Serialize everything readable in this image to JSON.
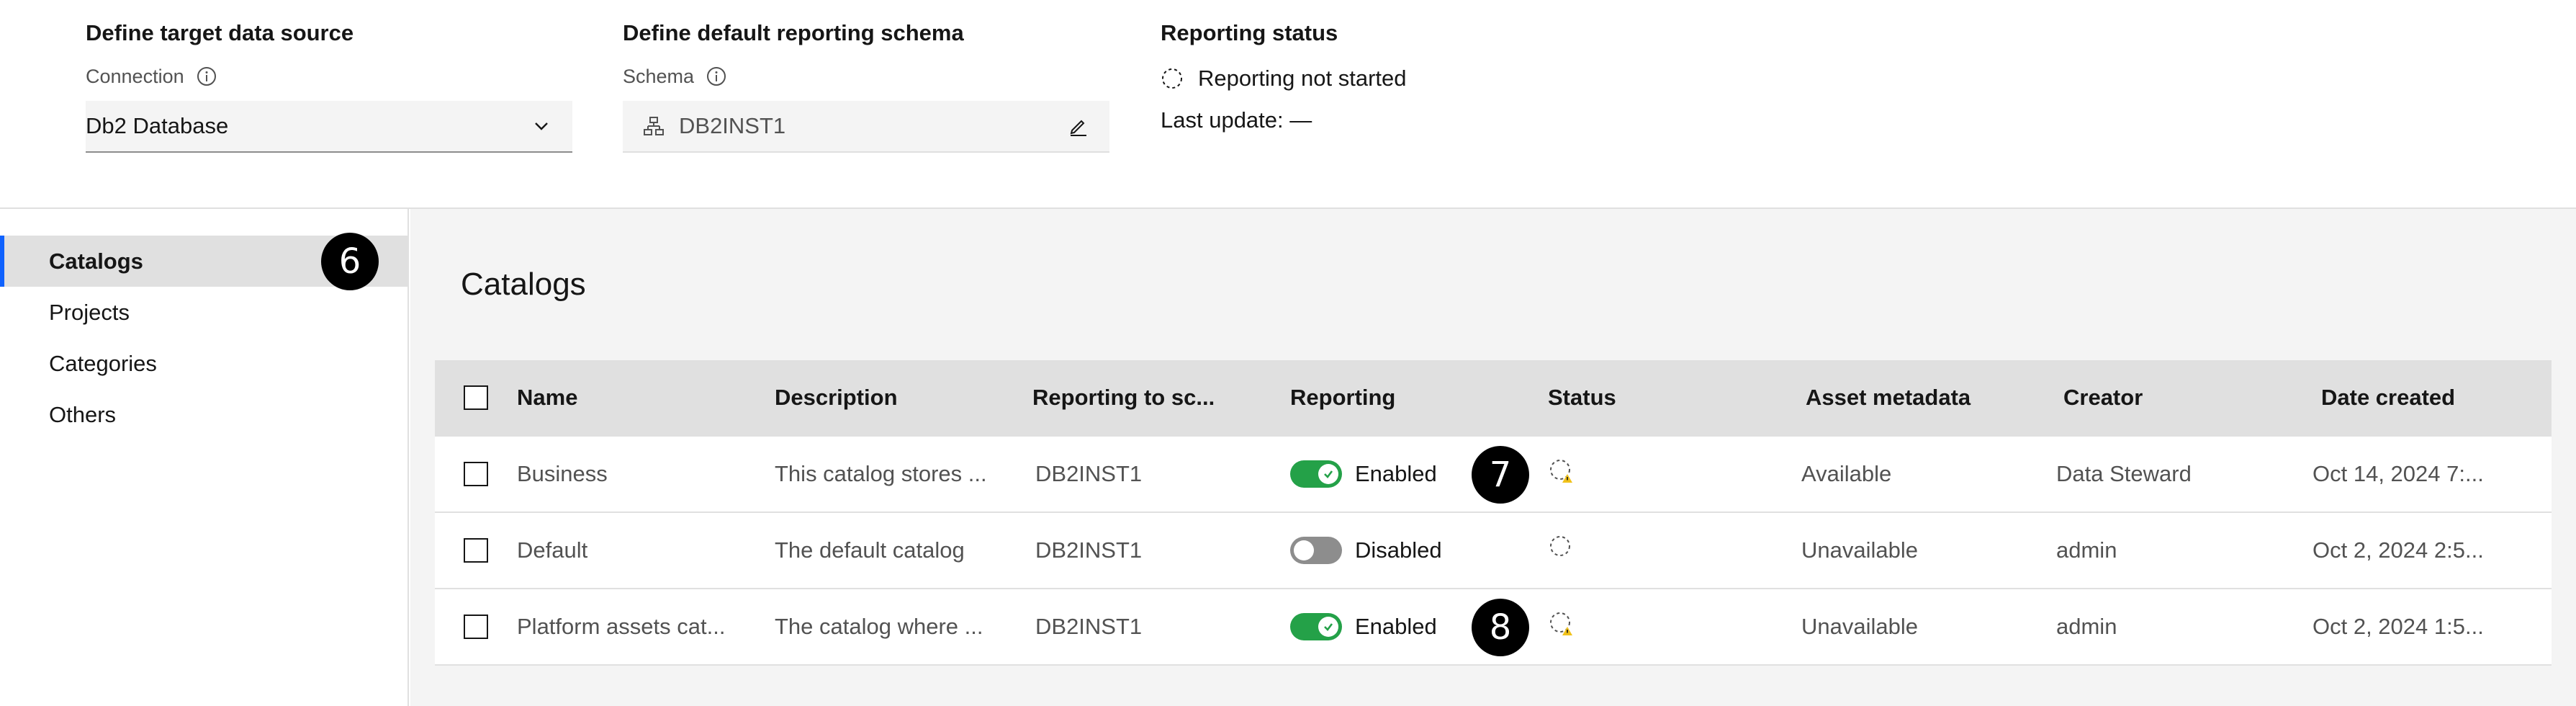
{
  "target": {
    "title": "Define target data source",
    "label": "Connection",
    "value": "Db2 Database"
  },
  "schema": {
    "title": "Define default reporting schema",
    "label": "Schema",
    "value": "DB2INST1"
  },
  "reporting_status": {
    "title": "Reporting status",
    "status": "Reporting not started",
    "last_update": "Last update: —"
  },
  "sidebar": {
    "items": [
      {
        "label": "Catalogs",
        "active": true
      },
      {
        "label": "Projects"
      },
      {
        "label": "Categories"
      },
      {
        "label": "Others"
      }
    ]
  },
  "callouts": {
    "six": "6",
    "seven": "7",
    "eight": "8"
  },
  "main": {
    "title": "Catalogs",
    "columns": {
      "name": "Name",
      "description": "Description",
      "reporting_to": "Reporting to sc...",
      "reporting": "Reporting",
      "status": "Status",
      "asset": "Asset metadata",
      "creator": "Creator",
      "date": "Date created"
    },
    "rows": [
      {
        "name": "Business",
        "description": "This catalog stores ...",
        "schema": "DB2INST1",
        "reporting": "Enabled",
        "reporting_on": true,
        "status_icon": "pending-warning-icon",
        "asset": "Available",
        "creator": "Data Steward",
        "date": "Oct 14, 2024 7:..."
      },
      {
        "name": "Default",
        "description": "The default catalog",
        "schema": "DB2INST1",
        "reporting": "Disabled",
        "reporting_on": false,
        "status_icon": "pending-icon",
        "asset": "Unavailable",
        "creator": "admin",
        "date": "Oct 2, 2024 2:5..."
      },
      {
        "name": "Platform assets cat...",
        "description": "The catalog where ...",
        "schema": "DB2INST1",
        "reporting": "Enabled",
        "reporting_on": true,
        "status_icon": "pending-warning-icon",
        "asset": "Unavailable",
        "creator": "admin",
        "date": "Oct 2, 2024 1:5..."
      }
    ]
  },
  "colors": {
    "accent": "#0f62fe",
    "toggle_on": "#24a148",
    "toggle_off": "#8d8d8d",
    "warning": "#f1c21b"
  }
}
